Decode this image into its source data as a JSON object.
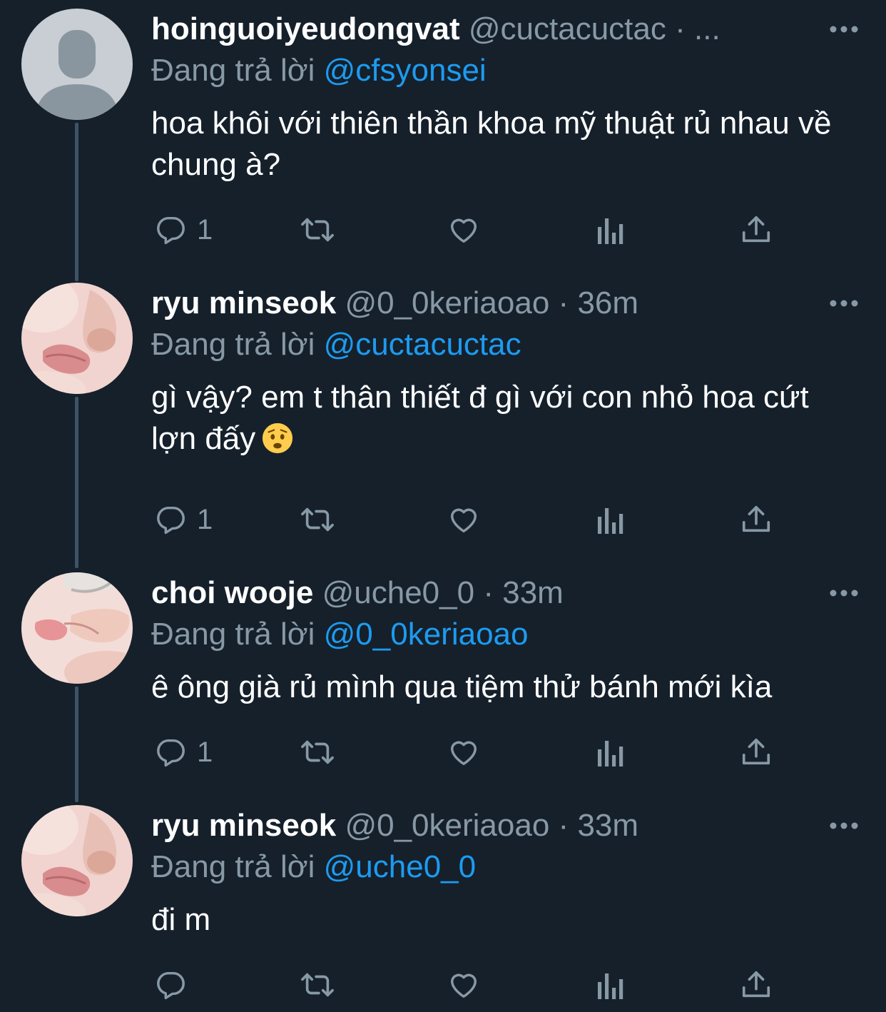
{
  "thread": {
    "reply_prefix": "Đang trả lời",
    "separator": "·",
    "tweets": [
      {
        "display_name": "hoinguoiyeudongvat",
        "handle": "@cuctacuctac",
        "time": "...",
        "replying_to": "@cfsyonsei",
        "text": "hoa khôi với thiên thần khoa mỹ thuật rủ nhau về chung à?",
        "emoji": "",
        "reply_count": "1",
        "avatar": "default-profile-icon"
      },
      {
        "display_name": "ryu minseok",
        "handle": "@0_0keriaoao",
        "time": "36m",
        "replying_to": "@cuctacuctac",
        "text": "gì vậy? em t thân thiết đ gì với con nhỏ hoa cứt lợn đấy",
        "emoji": "worried-face-emoji",
        "reply_count": "1",
        "avatar": "face-photo-avatar"
      },
      {
        "display_name": "choi wooje",
        "handle": "@uche0_0",
        "time": "33m",
        "replying_to": "@0_0keriaoao",
        "text": "ê ông già rủ mình qua tiệm thử bánh mới kìa",
        "emoji": "",
        "reply_count": "1",
        "avatar": "face-photo-avatar"
      },
      {
        "display_name": "ryu minseok",
        "handle": "@0_0keriaoao",
        "time": "33m",
        "replying_to": "@uche0_0",
        "text": "đi m",
        "emoji": "",
        "reply_count": "",
        "avatar": "face-photo-avatar"
      }
    ]
  },
  "colors": {
    "background": "#15202b",
    "text": "#ffffff",
    "muted": "#8899a6",
    "link": "#1d9bf0",
    "connector": "#3d5466"
  }
}
